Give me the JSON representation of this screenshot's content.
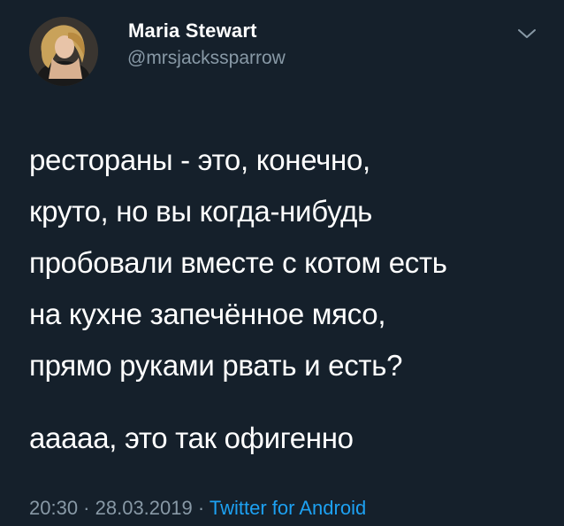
{
  "author": {
    "name": "Maria Stewart",
    "handle": "@mrsjackssparrow",
    "avatar_icon": "profile-photo"
  },
  "menu": {
    "icon": "chevron-down-icon"
  },
  "tweet": {
    "lines": [
      "рестораны - это, конечно,",
      "круто, но вы когда-нибудь",
      "пробовали вместе с котом есть",
      "на кухне запечённое мясо,",
      "прямо руками рвать и есть?"
    ],
    "second_paragraph": "ааааа, это так офигенно"
  },
  "meta": {
    "time": "20:30",
    "separator1": " · ",
    "date": "28.03.2019",
    "separator2": " · ",
    "source": "Twitter for Android"
  },
  "colors": {
    "background": "#15202b",
    "text": "#ffffff",
    "secondary": "#8899a6",
    "link": "#1da1f2"
  }
}
